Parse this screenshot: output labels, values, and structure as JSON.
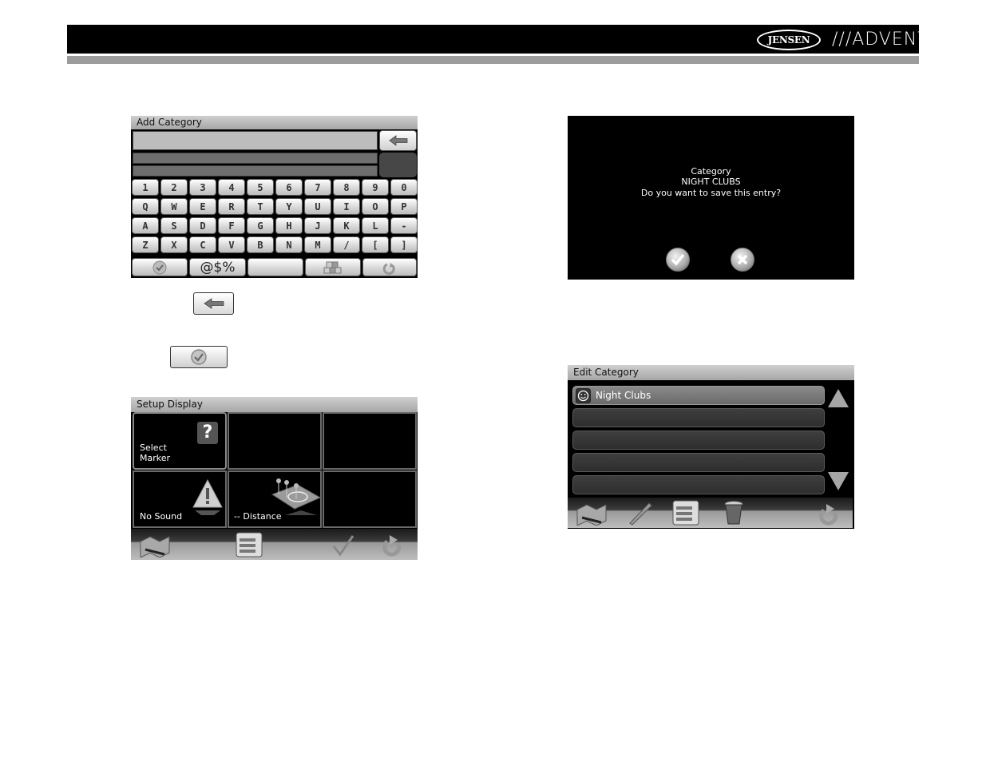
{
  "header": {
    "brand_left": "JENSEN",
    "brand_right": "///ADVENT"
  },
  "add_category": {
    "title": "Add Category",
    "input_value": "",
    "backspace_icon": "arrow-left-icon",
    "rows": [
      [
        "1",
        "2",
        "3",
        "4",
        "5",
        "6",
        "7",
        "8",
        "9",
        "0"
      ],
      [
        "Q",
        "W",
        "E",
        "R",
        "T",
        "Y",
        "U",
        "I",
        "O",
        "P"
      ],
      [
        "A",
        "S",
        "D",
        "F",
        "G",
        "H",
        "J",
        "K",
        "L",
        "-"
      ],
      [
        "Z",
        "X",
        "C",
        "V",
        "B",
        "N",
        "M",
        "/",
        "[",
        "]"
      ]
    ],
    "bottom_row": {
      "ok_icon": "checkmark-icon",
      "symbols_label": "@$%",
      "space_label": "",
      "layout_icon": "keyboard-layout-icon",
      "back_icon": "back-arrow-icon"
    }
  },
  "legend_buttons": {
    "backspace_icon": "arrow-left-icon",
    "ok_icon": "checkmark-icon"
  },
  "setup_display": {
    "title": "Setup Display",
    "cells": [
      {
        "label_line1": "Select",
        "label_line2": "Marker",
        "icon": "question-mark-icon"
      },
      {
        "label_line1": "",
        "label_line2": "",
        "icon": ""
      },
      {
        "label_line1": "",
        "label_line2": "",
        "icon": ""
      },
      {
        "label_line1": "No Sound",
        "label_line2": "",
        "icon": "warning-icon"
      },
      {
        "label_line1": "-- Distance",
        "label_line2": "",
        "icon": "map-pins-icon"
      },
      {
        "label_line1": "",
        "label_line2": "",
        "icon": ""
      }
    ],
    "toolbar": [
      "map-icon",
      "list-icon",
      "check-icon",
      "back-arrow-icon"
    ]
  },
  "save_dialog": {
    "line1": "Category",
    "line2": "NIGHT CLUBS",
    "line3": "Do you want to save this entry?",
    "confirm_icon": "checkmark-icon",
    "cancel_icon": "close-icon"
  },
  "edit_category": {
    "title": "Edit Category",
    "items": [
      {
        "label": "Night Clubs",
        "icon": "smiley-icon",
        "selected": true
      },
      {
        "label": "",
        "icon": "",
        "selected": false
      },
      {
        "label": "",
        "icon": "",
        "selected": false
      },
      {
        "label": "",
        "icon": "",
        "selected": false
      },
      {
        "label": "",
        "icon": "",
        "selected": false
      }
    ],
    "toolbar": [
      "map-icon",
      "pencil-icon",
      "list-icon",
      "trash-icon",
      "back-arrow-icon"
    ]
  }
}
